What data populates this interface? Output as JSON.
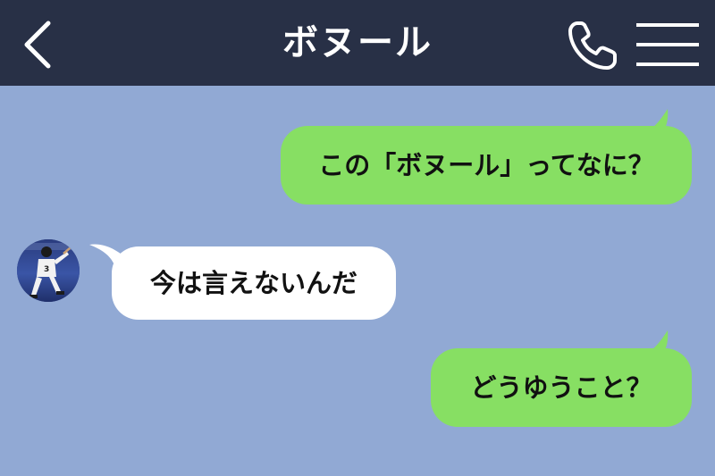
{
  "header": {
    "title": "ボヌール"
  },
  "messages": [
    {
      "direction": "outgoing",
      "text": "この「ボヌール」ってなに？"
    },
    {
      "direction": "incoming",
      "text": "今は言えないんだ"
    },
    {
      "direction": "outgoing",
      "text": "どうゆうこと？"
    }
  ],
  "icons": {
    "back": "back-chevron-icon",
    "call": "phone-icon",
    "menu": "hamburger-menu-icon",
    "avatar": "contact-avatar"
  },
  "colors": {
    "header_bg": "#283046",
    "chat_bg": "#91a9d4",
    "outgoing_bubble": "#87df63",
    "incoming_bubble": "#ffffff"
  }
}
